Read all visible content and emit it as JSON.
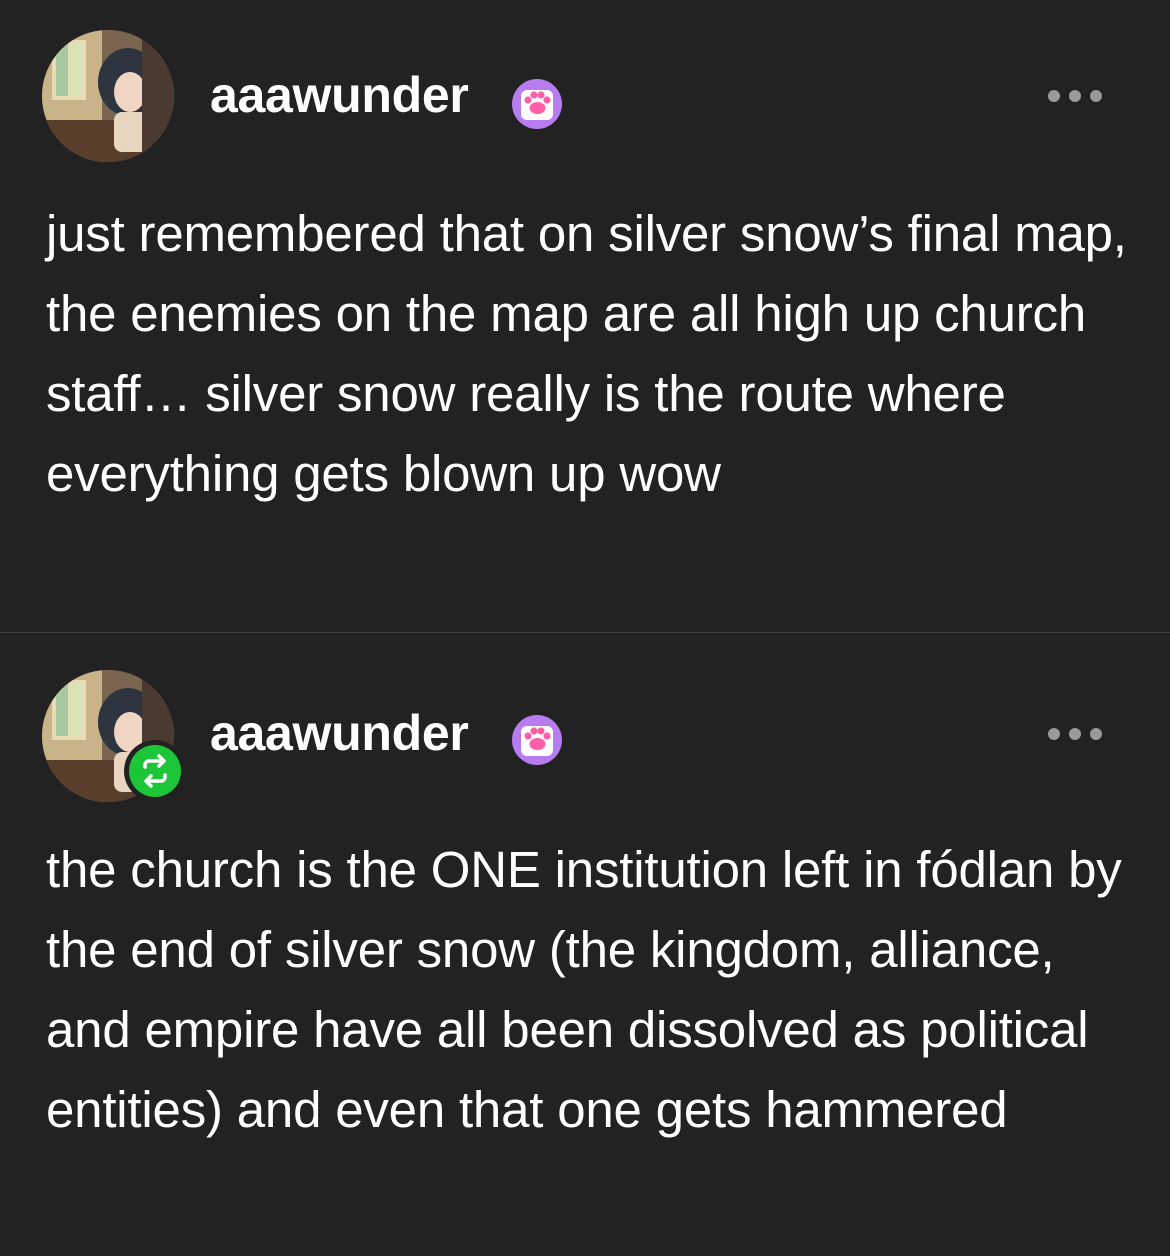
{
  "posts": [
    {
      "username": "aaawunder",
      "badge_icon": "paw-icon",
      "menu_icon": "more-horizontal-icon",
      "text": "just remembered that on silver snow’s final map, the enemies on the map are all high up church staff… silver snow really is the route where everything gets blown up wow",
      "reblogged": false
    },
    {
      "username": "aaawunder",
      "badge_icon": "paw-icon",
      "menu_icon": "more-horizontal-icon",
      "text": "the church is the ONE institution left in fódlan by the end of silver snow (the kingdom, alliance, and empire have all been dissolved as political entities) and even that one gets hammered",
      "reblogged": true,
      "reblog_icon": "reblog-icon"
    }
  ],
  "colors": {
    "background": "#222222",
    "text": "#ffffff",
    "divider": "#3f3f3f",
    "reblog_green": "#1dc639",
    "badge_purple": "#b77cf0",
    "paw_pink": "#ff5fa8",
    "menu_dots": "#9a9a9a"
  }
}
